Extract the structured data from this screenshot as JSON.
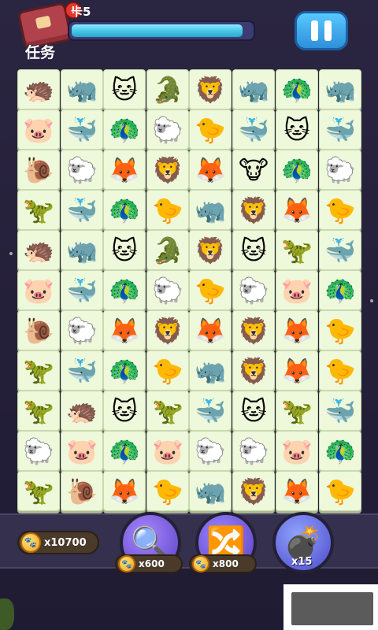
{
  "header": {
    "task_label": "任务",
    "level_text": "卡5",
    "alert_badge": "!",
    "progress": 0.95
  },
  "board": {
    "rows": [
      [
        "hedgehog",
        "rhino",
        "cat",
        "crocodile",
        "lion",
        "rhino",
        "peacock",
        "rhino"
      ],
      [
        "pig",
        "whale",
        "peacock",
        "sheep",
        "chick",
        "whale",
        "cat",
        "whale"
      ],
      [
        "snail",
        "sheep",
        "fox",
        "lion",
        "fox",
        "cow",
        "peacock",
        "sheep"
      ],
      [
        "dinosaur",
        "whale",
        "peacock",
        "chick",
        "rhino",
        "lion",
        "fox",
        "chick"
      ],
      [
        "hedgehog",
        "rhino",
        "cat",
        "crocodile",
        "lion",
        "cat",
        "dinosaur",
        "whale"
      ],
      [
        "pig",
        "whale",
        "peacock",
        "sheep",
        "chick",
        "sheep",
        "pig",
        "peacock"
      ],
      [
        "snail",
        "sheep",
        "fox",
        "lion",
        "fox",
        "lion",
        "fox",
        "chick"
      ],
      [
        "dinosaur",
        "whale",
        "peacock",
        "chick",
        "rhino",
        "lion",
        "fox",
        "chick"
      ],
      [
        "dinosaur",
        "hedgehog",
        "cat",
        "dinosaur",
        "whale",
        "cat",
        "dinosaur",
        "whale"
      ],
      [
        "sheep",
        "pig",
        "peacock",
        "pig",
        "sheep",
        "sheep",
        "pig",
        "peacock"
      ],
      [
        "dinosaur",
        "snail",
        "fox",
        "chick",
        "rhino",
        "lion",
        "fox",
        "chick"
      ]
    ],
    "glyphs": {
      "hedgehog": "🦔",
      "rhino": "🦏",
      "cat": "🐱",
      "crocodile": "🐊",
      "lion": "🦁",
      "peacock": "🦚",
      "pig": "🐷",
      "whale": "🐳",
      "sheep": "🐑",
      "chick": "🐤",
      "snail": "🐌",
      "fox": "🦊",
      "cow": "🐮",
      "dinosaur": "🦖"
    }
  },
  "footer": {
    "coins": "x10700",
    "magnifier_cost": "x600",
    "swap_cost": "x800",
    "bomb_count": "x15",
    "coin_icon": "🐾"
  }
}
